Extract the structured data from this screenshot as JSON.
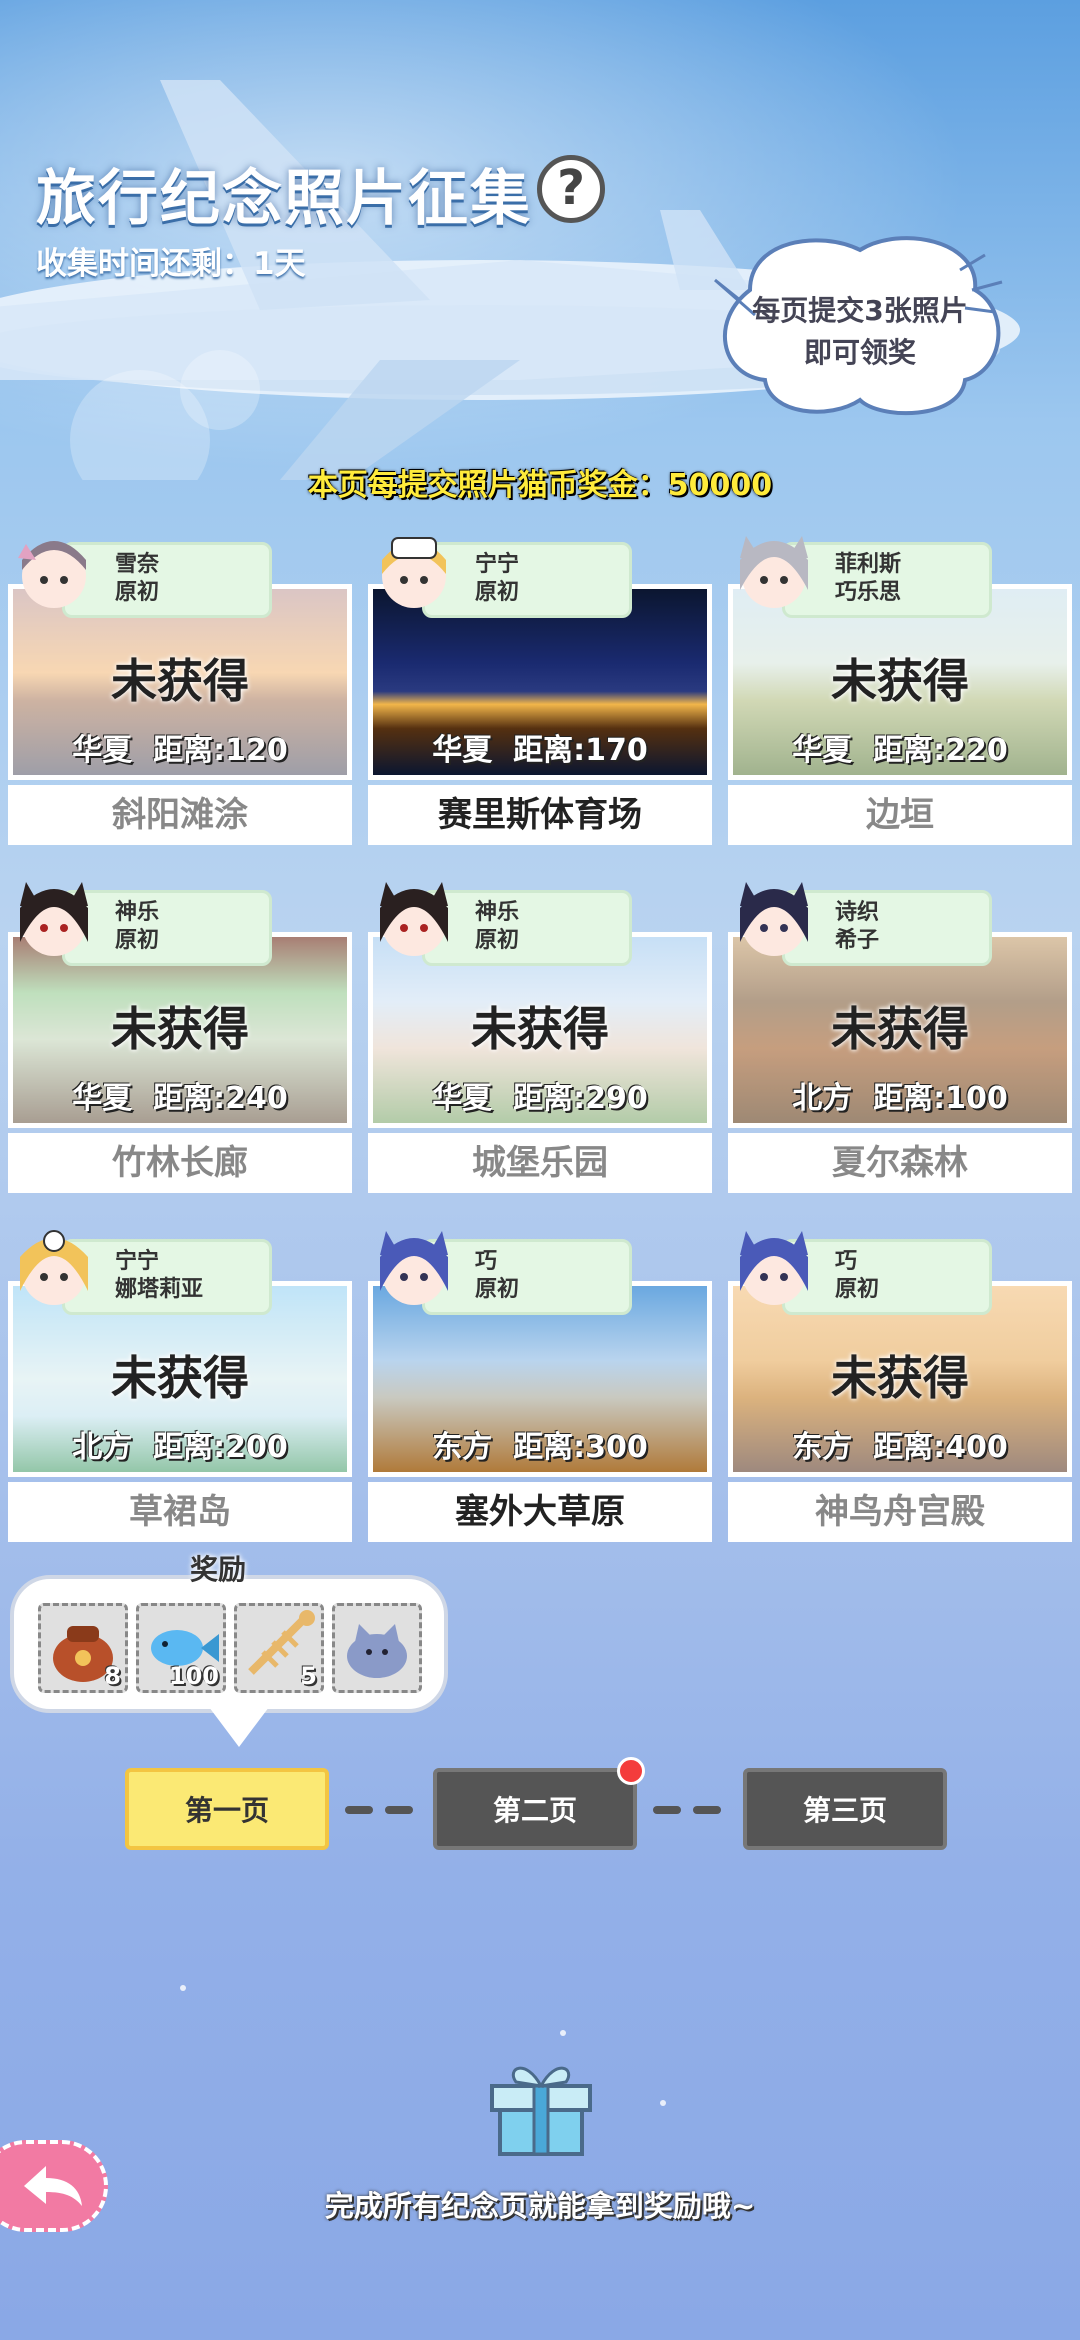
{
  "header": {
    "title": "旅行纪念照片征集",
    "help_symbol": "?",
    "timer": "收集时间还剩：1天",
    "bubble_line1": "每页提交3张照片",
    "bubble_line2": "即可领奖",
    "reward_line": "本页每提交照片猫币奖金：50000"
  },
  "cards": [
    {
      "chars": "雪奈",
      "chars2": "原初",
      "status": "未获得",
      "region": "华夏",
      "distance": "距离:120",
      "name": "斜阳滩涂",
      "obtained": false,
      "photo_colors": [
        "#f4c28a",
        "#c9a9a0",
        "#6b6b7a"
      ]
    },
    {
      "chars": "宁宁",
      "chars2": "原初",
      "status": "",
      "region": "华夏",
      "distance": "距离:170",
      "name": "赛里斯体育场",
      "obtained": true,
      "photo_colors": [
        "#0b1630",
        "#2a3a80",
        "#f2b64a"
      ]
    },
    {
      "chars": "菲利斯",
      "chars2": "巧乐思",
      "status": "未获得",
      "region": "华夏",
      "distance": "距离:220",
      "name": "边垣",
      "obtained": false,
      "photo_colors": [
        "#cfe4ee",
        "#b9c48e",
        "#6f8a52"
      ]
    },
    {
      "chars": "神乐",
      "chars2": "原初",
      "status": "未获得",
      "region": "华夏",
      "distance": "距离:240",
      "name": "竹林长廊",
      "obtained": false,
      "photo_colors": [
        "#9dcf9a",
        "#c9d9c0",
        "#7a6a58"
      ]
    },
    {
      "chars": "神乐",
      "chars2": "原初",
      "status": "未获得",
      "region": "华夏",
      "distance": "距离:290",
      "name": "城堡乐园",
      "obtained": false,
      "photo_colors": [
        "#a9cff2",
        "#e8d7c8",
        "#8ab07a"
      ]
    },
    {
      "chars": "诗织",
      "chars2": "希子",
      "status": "未获得",
      "region": "北方",
      "distance": "距离:100",
      "name": "夏尔森林",
      "obtained": false,
      "photo_colors": [
        "#c9a77a",
        "#8a6a4a",
        "#a86a3a"
      ]
    },
    {
      "chars": "宁宁",
      "chars2": "娜塔莉亚",
      "status": "未获得",
      "region": "北方",
      "distance": "距离:200",
      "name": "草裙岛",
      "obtained": false,
      "photo_colors": [
        "#9ed6f4",
        "#dceef0",
        "#5aa87a"
      ]
    },
    {
      "chars": "巧",
      "chars2": "原初",
      "status": "",
      "region": "东方",
      "distance": "距离:300",
      "name": "塞外大草原",
      "obtained": true,
      "photo_colors": [
        "#6aa8e0",
        "#c9c9c0",
        "#b07a3a"
      ]
    },
    {
      "chars": "巧",
      "chars2": "原初",
      "status": "未获得",
      "region": "东方",
      "distance": "距离:400",
      "name": "神鸟舟宫殿",
      "obtained": false,
      "photo_colors": [
        "#f4c68a",
        "#c98a3a",
        "#6a4a3a"
      ]
    }
  ],
  "rewards": {
    "label": "奖励",
    "items": [
      {
        "icon": "treasure-bag-icon",
        "count": "8"
      },
      {
        "icon": "blue-fish-icon",
        "count": "100"
      },
      {
        "icon": "fish-bone-icon",
        "count": "5"
      },
      {
        "icon": "cat-blob-icon",
        "count": ""
      }
    ]
  },
  "pages": {
    "page1": "第一页",
    "page2": "第二页",
    "page3": "第三页"
  },
  "footer": {
    "text": "完成所有纪念页就能拿到奖励哦~"
  }
}
